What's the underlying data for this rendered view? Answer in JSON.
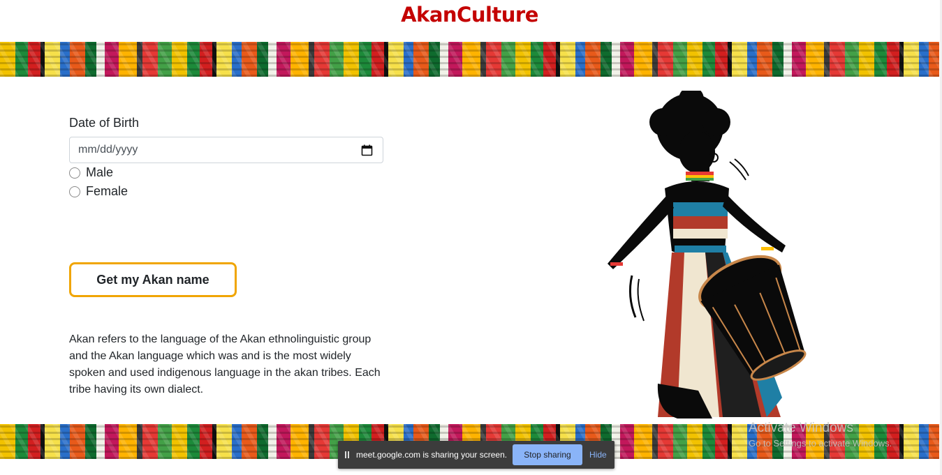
{
  "header": {
    "title": "AkanCulture"
  },
  "form": {
    "dob_label": "Date of Birth",
    "date_placeholder": "mm/dd/yyyy",
    "genders": [
      {
        "label": "Male"
      },
      {
        "label": "Female"
      }
    ],
    "submit_label": "Get my Akan name"
  },
  "about": {
    "text": "Akan refers to the language of the Akan ethnolinguistic group and the Akan language which was and is the most widely spoken and used indigenous language in the akan tribes. Each tribe having its own dialect."
  },
  "watermark": {
    "title": "Activate Windows",
    "subtitle": "Go to Settings to activate Windows."
  },
  "share_bar": {
    "message": "meet.google.com is sharing your screen.",
    "stop_label": "Stop sharing",
    "hide_label": "Hide"
  },
  "colors": {
    "brand": "#c40000",
    "button_border": "#f0a500",
    "share_button": "#8ab4f8"
  },
  "icons": [
    "calendar-icon",
    "pause-grip-icon"
  ]
}
